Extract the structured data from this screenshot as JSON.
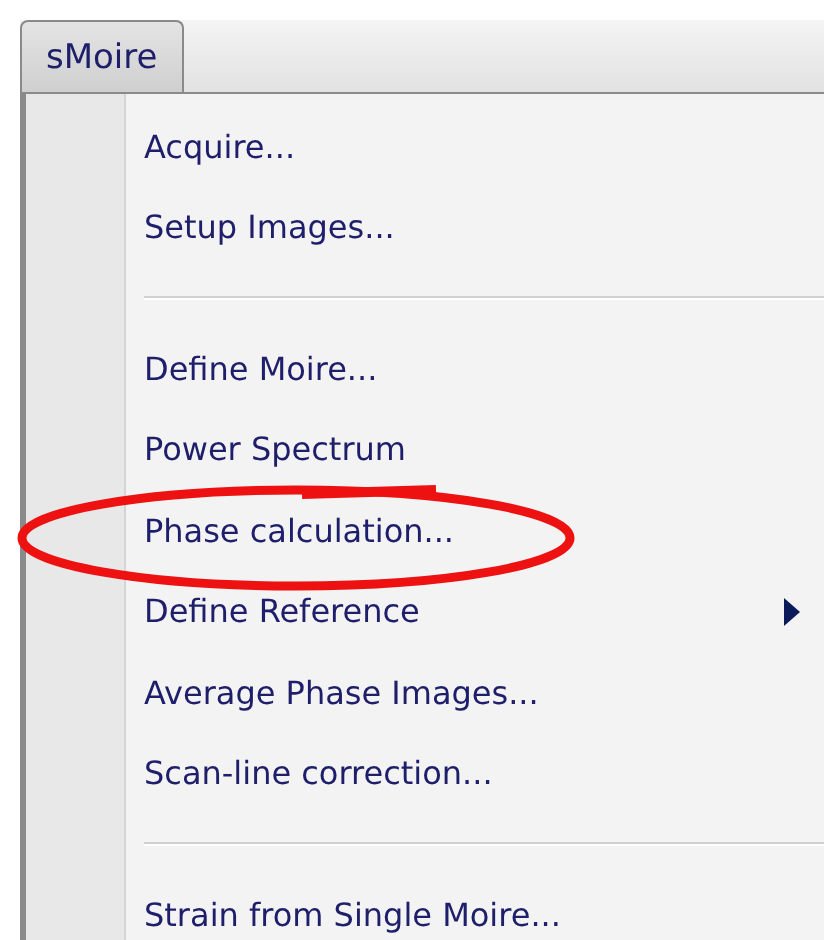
{
  "menu_bar": {
    "tabs": [
      {
        "label": "sMoire",
        "selected": true
      }
    ]
  },
  "menu": {
    "items": [
      {
        "kind": "item",
        "label": "Acquire...",
        "circled": false
      },
      {
        "kind": "item",
        "label": "Setup Images...",
        "circled": false
      },
      {
        "kind": "separator"
      },
      {
        "kind": "item",
        "label": "Define Moire...",
        "circled": false
      },
      {
        "kind": "item",
        "label": "Power Spectrum",
        "circled": false
      },
      {
        "kind": "item",
        "label": "Phase calculation...",
        "circled": true
      },
      {
        "kind": "submenu",
        "label": "Define Reference",
        "circled": false
      },
      {
        "kind": "item",
        "label": "Average Phase Images...",
        "circled": false
      },
      {
        "kind": "item",
        "label": "Scan-line correction...",
        "circled": false
      },
      {
        "kind": "separator"
      },
      {
        "kind": "item",
        "label": "Strain from Single Moire...",
        "circled": false
      }
    ]
  }
}
